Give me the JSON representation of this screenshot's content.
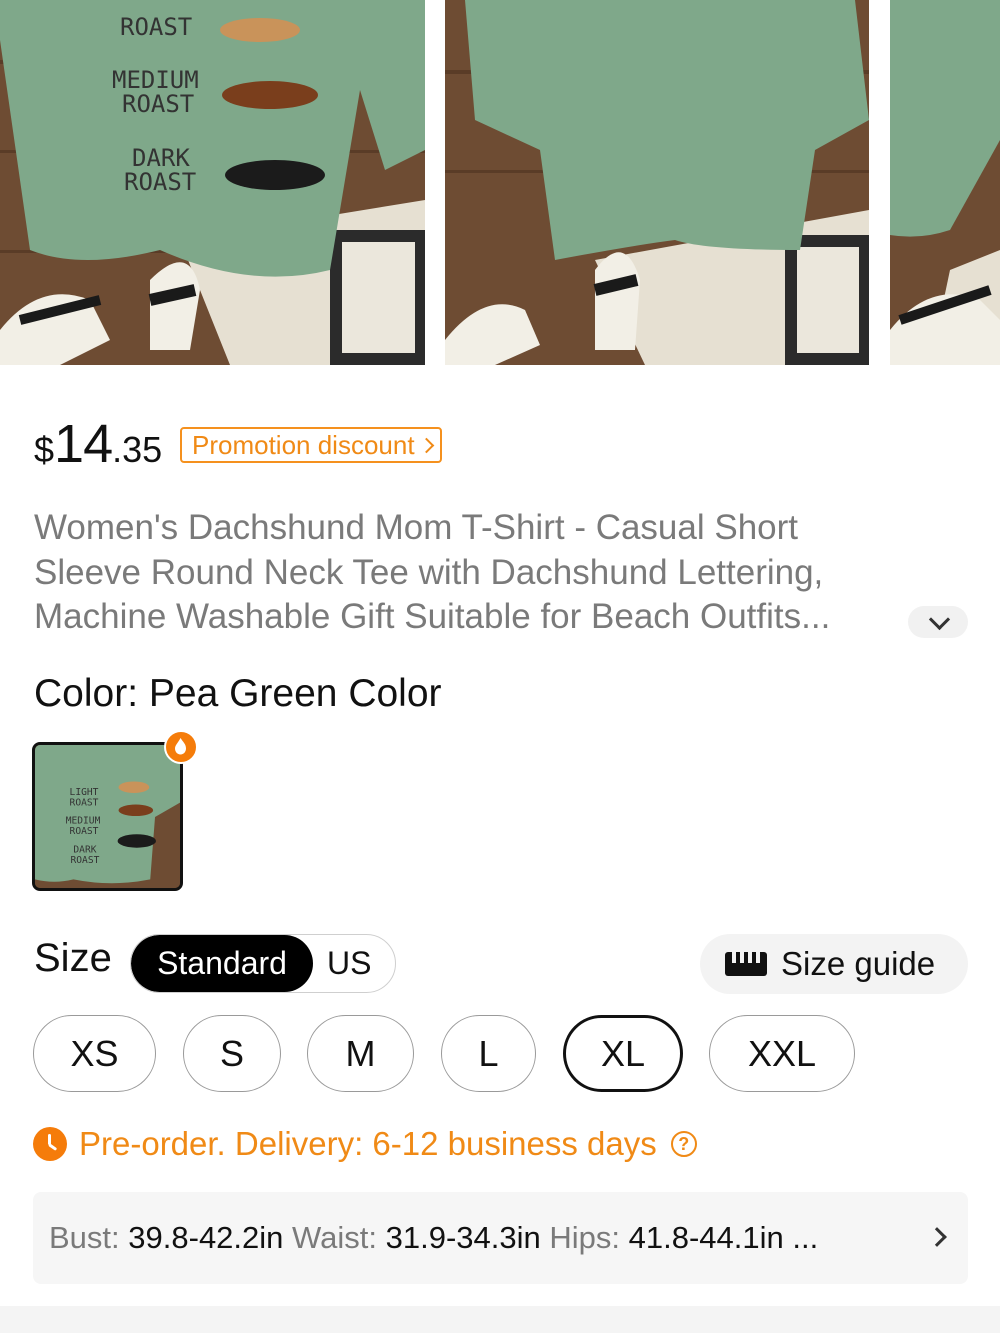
{
  "gallery": {
    "images": [
      {
        "icon": "product-photo-front-tee"
      },
      {
        "icon": "product-photo-full-tee"
      },
      {
        "icon": "product-photo-partial"
      }
    ],
    "print_text": [
      "LIGHT",
      "ROAST",
      "MEDIUM",
      "ROAST",
      "DARK",
      "ROAST"
    ]
  },
  "price": {
    "currency": "$",
    "integer": "14",
    "decimal": ".35",
    "promotion_label": "Promotion discount"
  },
  "product": {
    "title": "Women's Dachshund Mom T-Shirt - Casual Short Sleeve Round Neck Tee with Dachshund Lettering, Machine Washable Gift Suitable for Beach Outfits..."
  },
  "color": {
    "label": "Color: Pea Green Color"
  },
  "size": {
    "label": "Size",
    "systems": [
      "Standard",
      "US"
    ],
    "selected_system": "Standard",
    "guide_label": "Size guide",
    "options": [
      "XS",
      "S",
      "M",
      "L",
      "XL",
      "XXL"
    ],
    "selected": "XL"
  },
  "delivery": {
    "text": "Pre-order. Delivery: 6-12 business days"
  },
  "measurements": {
    "bust_label": "Bust:",
    "bust_value": "39.8-42.2in",
    "waist_label": "Waist:",
    "waist_value": "31.9-34.3in",
    "hips_label": "Hips:",
    "hips_value": "41.8-44.1in",
    "more": "..."
  },
  "colors": {
    "accent": "#f08a16",
    "shirt": "#7fa88a",
    "wood": "#6b4a33"
  }
}
